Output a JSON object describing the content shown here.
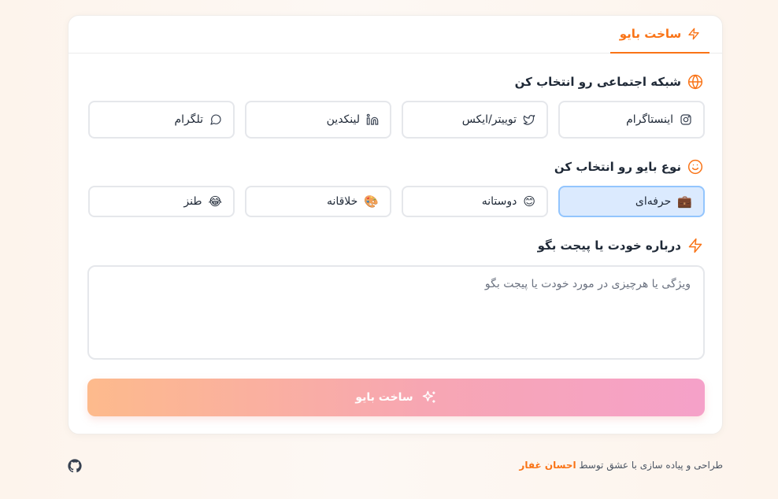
{
  "tab": {
    "label": "ساخت بایو",
    "icon": "zap-icon"
  },
  "social": {
    "title": "شبکه اجتماعی رو انتخاب کن",
    "icon": "globe-icon",
    "options": [
      {
        "label": "اینستاگرام",
        "icon": "instagram-icon"
      },
      {
        "label": "توییتر/ایکس",
        "icon": "twitter-icon"
      },
      {
        "label": "لینکدین",
        "icon": "linkedin-icon"
      },
      {
        "label": "تلگرام",
        "icon": "message-circle-icon"
      }
    ]
  },
  "bio_type": {
    "title": "نوع بایو رو انتخاب کن",
    "icon": "smile-icon",
    "options": [
      {
        "label": "حرفه‌ای",
        "emoji": "💼",
        "selected": true
      },
      {
        "label": "دوستانه",
        "emoji": "😊"
      },
      {
        "label": "خلاقانه",
        "emoji": "🎨"
      },
      {
        "label": "طنز",
        "emoji": "😂"
      }
    ]
  },
  "about": {
    "title": "درباره خودت یا پیجت بگو",
    "icon": "zap-icon",
    "placeholder": "ویژگی یا هرچیزی در مورد خودت یا پیجت بگو",
    "value": ""
  },
  "submit": {
    "label": "ساخت بایو",
    "icon": "sparkles-icon"
  },
  "footer": {
    "text": "طراحی و پیاده سازی با عشق توسط",
    "author": "احسان غفار",
    "icon": "github-icon"
  },
  "colors": {
    "accent": "#f97316",
    "selected_bg": "#dbeafe",
    "selected_border": "#93c5fd"
  }
}
